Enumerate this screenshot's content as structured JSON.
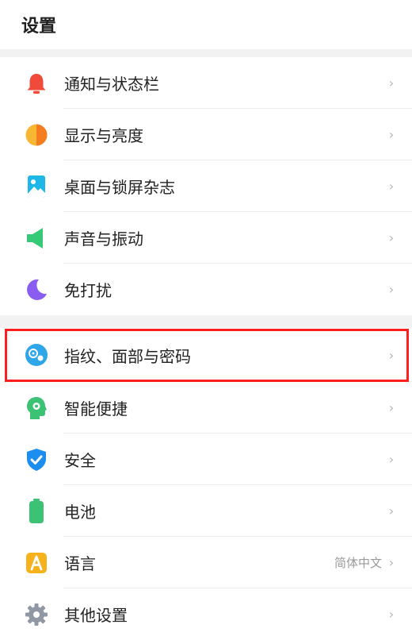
{
  "header": {
    "title": "设置"
  },
  "group1": [
    {
      "name": "row-notifications",
      "icon": "bell-icon",
      "label": "通知与状态栏"
    },
    {
      "name": "row-display",
      "icon": "brightness-icon",
      "label": "显示与亮度"
    },
    {
      "name": "row-wallpaper",
      "icon": "wallpaper-icon",
      "label": "桌面与锁屏杂志"
    },
    {
      "name": "row-sound",
      "icon": "speaker-icon",
      "label": "声音与振动"
    },
    {
      "name": "row-dnd",
      "icon": "moon-icon",
      "label": "免打扰"
    }
  ],
  "group2": [
    {
      "name": "row-biometrics",
      "icon": "fingerprint-icon",
      "label": "指纹、面部与密码"
    },
    {
      "name": "row-smart-assist",
      "icon": "smart-assist-icon",
      "label": "智能便捷"
    },
    {
      "name": "row-security",
      "icon": "shield-icon",
      "label": "安全"
    },
    {
      "name": "row-battery",
      "icon": "battery-icon",
      "label": "电池"
    },
    {
      "name": "row-language",
      "icon": "language-icon",
      "label": "语言",
      "value": "简体中文"
    },
    {
      "name": "row-other",
      "icon": "gear-icon",
      "label": "其他设置"
    }
  ],
  "chevron": "›",
  "colors": {
    "highlight": "#ff1f1f",
    "background": "#ffffff",
    "separator": "#f2f2f2"
  }
}
